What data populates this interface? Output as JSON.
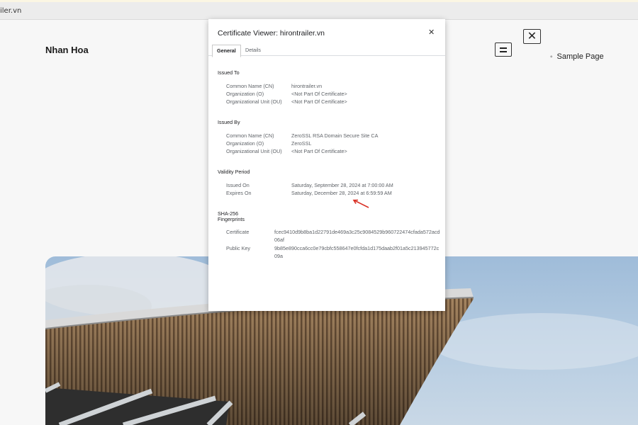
{
  "browser": {
    "address_text": "iler.vn"
  },
  "page": {
    "site_title": "Nhan Hoa",
    "menu_toggle_icon": "hamburger-icon",
    "close_icon_glyph": "✕",
    "nav_items": [
      "Sample Page"
    ]
  },
  "dialog": {
    "title": "Certificate Viewer: hirontrailer.vn",
    "close_glyph": "✕",
    "tabs": [
      "General",
      "Details"
    ],
    "issued_to": {
      "heading": "Issued To",
      "rows": [
        {
          "label": "Common Name (CN)",
          "value": "hirontrailer.vn"
        },
        {
          "label": "Organization (O)",
          "value": "<Not Part Of Certificate>"
        },
        {
          "label": "Organizational Unit (OU)",
          "value": "<Not Part Of Certificate>"
        }
      ]
    },
    "issued_by": {
      "heading": "Issued By",
      "rows": [
        {
          "label": "Common Name (CN)",
          "value": "ZeroSSL RSA Domain Secure Site CA"
        },
        {
          "label": "Organization (O)",
          "value": "ZeroSSL"
        },
        {
          "label": "Organizational Unit (OU)",
          "value": "<Not Part Of Certificate>"
        }
      ]
    },
    "validity": {
      "heading": "Validity Period",
      "rows": [
        {
          "label": "Issued On",
          "value": "Saturday, September 28, 2024 at 7:00:00 AM"
        },
        {
          "label": "Expires On",
          "value": "Saturday, December 28, 2024 at 6:59:59 AM"
        }
      ]
    },
    "fingerprints": {
      "heading_line1": "SHA-256",
      "heading_line2": "Fingerprints",
      "rows": [
        {
          "label": "Certificate",
          "value": "fcec9410d9b8ba1d22791de469a3c25c9084529b960722474cfada572acd06af"
        },
        {
          "label": "Public Key",
          "value": "9b85e890cca6cc0e79cbfc558647e0fcfda1d175daab2f01a5c213945772c09a"
        }
      ]
    }
  },
  "colors": {
    "annotation_arrow": "#d93025",
    "dialog_background": "#ffffff",
    "page_background": "#f7f7f7"
  }
}
